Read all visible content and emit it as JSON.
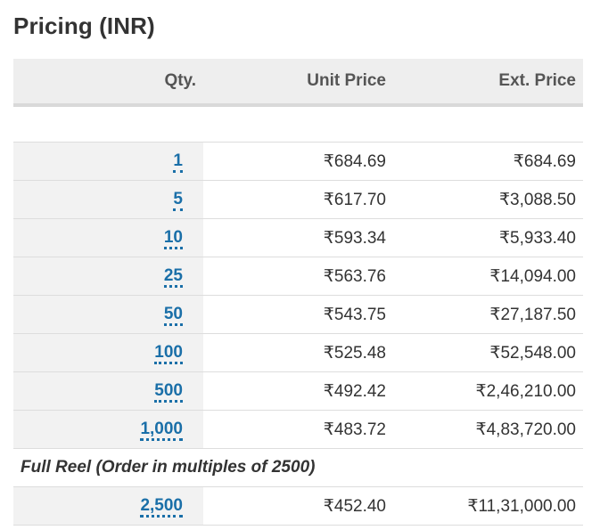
{
  "title": "Pricing (INR)",
  "columns": {
    "qty": "Qty.",
    "unit_price": "Unit Price",
    "ext_price": "Ext. Price"
  },
  "rows": [
    {
      "qty": "1",
      "unit": "₹684.69",
      "ext": "₹684.69"
    },
    {
      "qty": "5",
      "unit": "₹617.70",
      "ext": "₹3,088.50"
    },
    {
      "qty": "10",
      "unit": "₹593.34",
      "ext": "₹5,933.40"
    },
    {
      "qty": "25",
      "unit": "₹563.76",
      "ext": "₹14,094.00"
    },
    {
      "qty": "50",
      "unit": "₹543.75",
      "ext": "₹27,187.50"
    },
    {
      "qty": "100",
      "unit": "₹525.48",
      "ext": "₹52,548.00"
    },
    {
      "qty": "500",
      "unit": "₹492.42",
      "ext": "₹2,46,210.00"
    },
    {
      "qty": "1,000",
      "unit": "₹483.72",
      "ext": "₹4,83,720.00"
    }
  ],
  "full_reel": {
    "label": "Full Reel (Order in multiples of 2500)",
    "rows": [
      {
        "qty": "2,500",
        "unit": "₹452.40",
        "ext": "₹11,31,000.00"
      }
    ]
  },
  "colors": {
    "link": "#1a6fa8",
    "header_bg": "#eeeeee",
    "qty_cell_bg": "#f2f2f2"
  }
}
